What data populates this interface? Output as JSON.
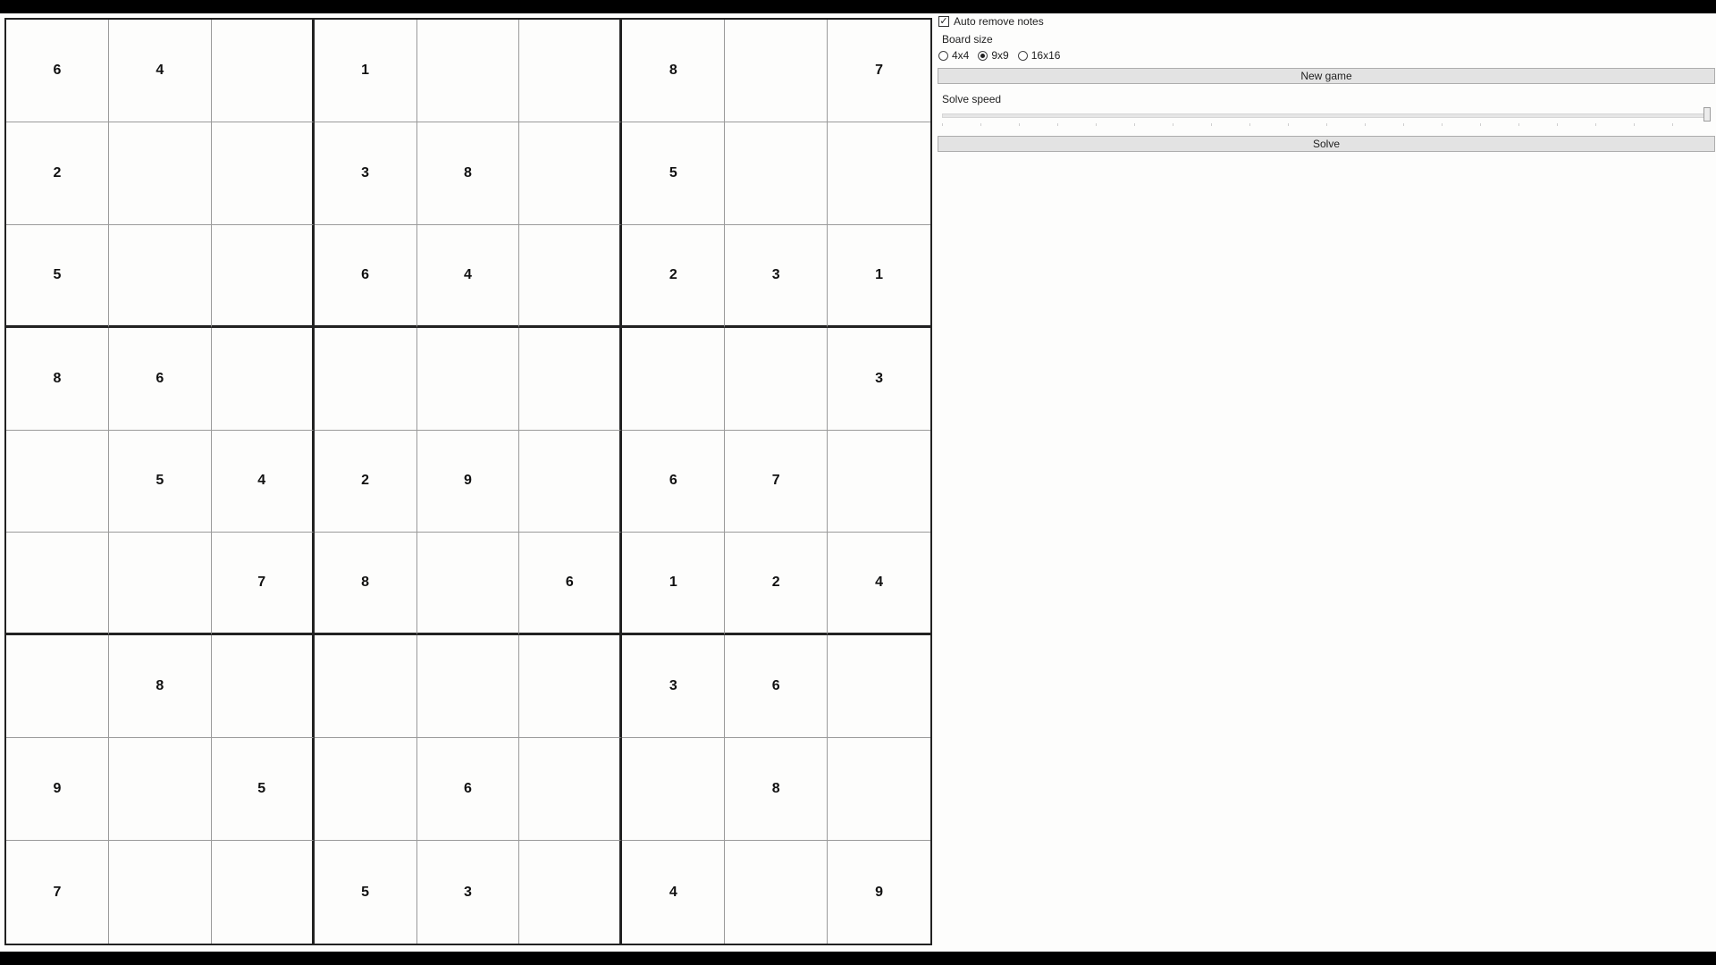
{
  "board": {
    "size": 9,
    "cells": [
      [
        "6",
        "4",
        "",
        "1",
        "",
        "",
        "8",
        "",
        "7"
      ],
      [
        "2",
        "",
        "",
        "3",
        "8",
        "",
        "5",
        "",
        ""
      ],
      [
        "5",
        "",
        "",
        "6",
        "4",
        "",
        "2",
        "3",
        "1"
      ],
      [
        "8",
        "6",
        "",
        "",
        "",
        "",
        "",
        "",
        "3"
      ],
      [
        "",
        "5",
        "4",
        "2",
        "9",
        "",
        "6",
        "7",
        ""
      ],
      [
        "",
        "",
        "7",
        "8",
        "",
        "6",
        "1",
        "2",
        "4"
      ],
      [
        "",
        "8",
        "",
        "",
        "",
        "",
        "3",
        "6",
        ""
      ],
      [
        "9",
        "",
        "5",
        "",
        "6",
        "",
        "",
        "8",
        ""
      ],
      [
        "7",
        "",
        "",
        "5",
        "3",
        "",
        "4",
        "",
        "9"
      ]
    ]
  },
  "panel": {
    "auto_remove_notes": {
      "label": "Auto remove notes",
      "checked": true,
      "check_glyph": "✓"
    },
    "board_size_label": "Board size",
    "board_size_options": [
      {
        "label": "4x4",
        "selected": false
      },
      {
        "label": "9x9",
        "selected": true
      },
      {
        "label": "16x16",
        "selected": false
      }
    ],
    "new_game_label": "New game",
    "solve_speed_label": "Solve speed",
    "solve_speed_value": 1.0,
    "solve_label": "Solve"
  }
}
